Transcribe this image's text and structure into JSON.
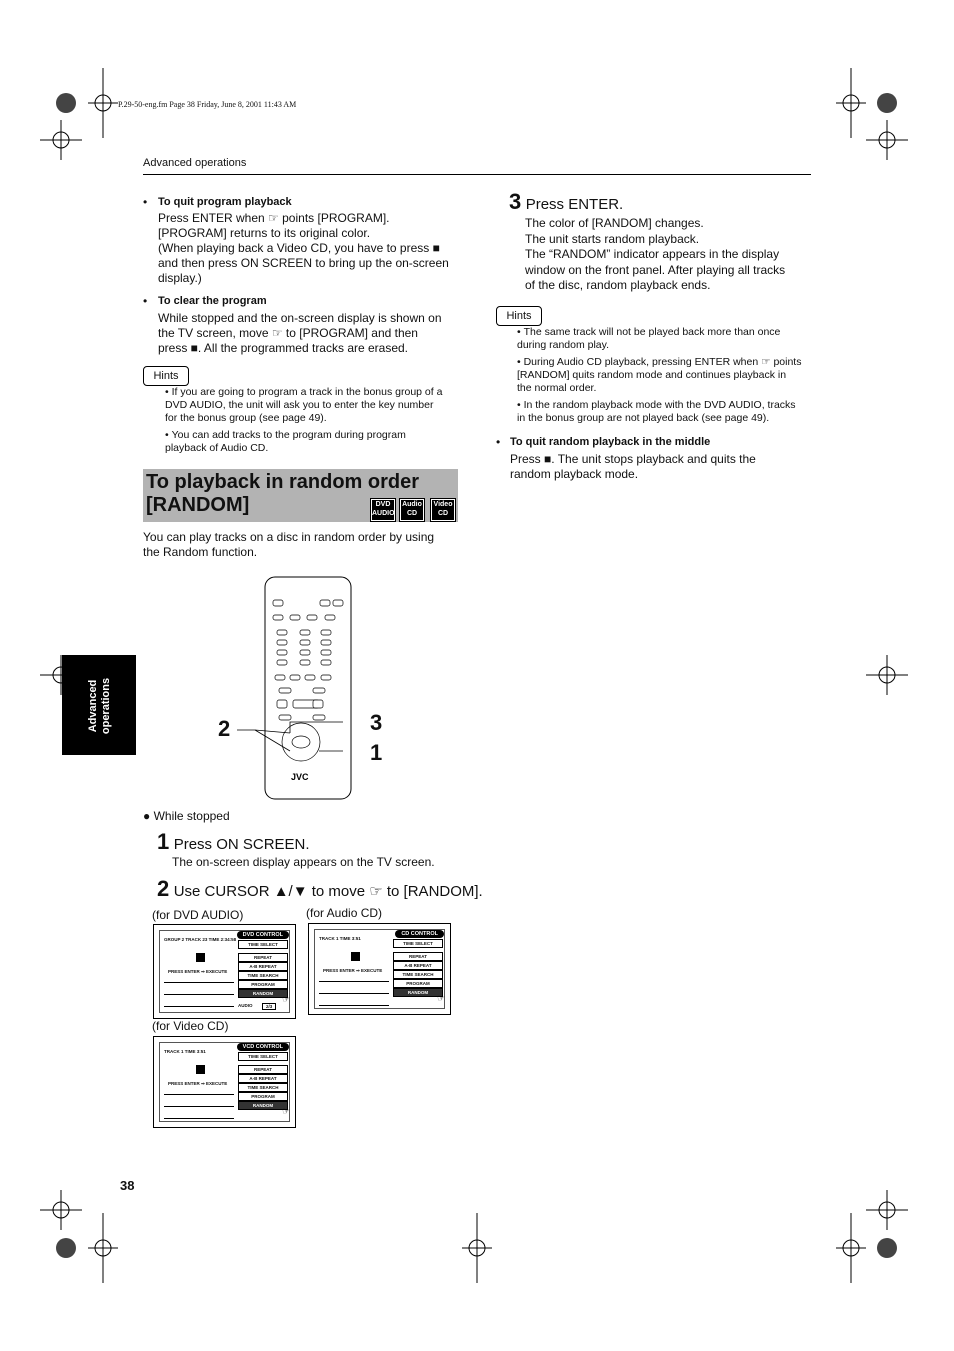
{
  "file_info": "P.29-50-eng.fm  Page 38  Friday, June 8, 2001  11:43 AM",
  "header": "Advanced operations",
  "side_tab": [
    "Advanced",
    "operations"
  ],
  "page_number": "38",
  "left": {
    "quit_program": {
      "heading": "To quit program playback",
      "lines": [
        "Press ENTER when ☞ points [PROGRAM].",
        "[PROGRAM] returns to its original color.",
        "(When playing back a Video CD, you have to press ■",
        "and then press ON SCREEN to bring up the on-screen",
        "display.)"
      ]
    },
    "clear_program": {
      "heading": "To clear the program",
      "lines": [
        "While stopped and the on-screen display is shown on",
        "the TV screen, move ☞ to [PROGRAM] and then",
        "press ■. All the programmed tracks are erased."
      ]
    },
    "hints_label": "Hints",
    "hints": [
      [
        "If you are going to program a track in the bonus group of a",
        "DVD AUDIO, the unit will ask you to enter the key number",
        "for the bonus group (see page 49)."
      ],
      [
        "You can add tracks to the program during program",
        "playback of Audio CD."
      ]
    ],
    "section_title": [
      "To playback  in random order",
      "[RANDOM]"
    ],
    "badges": [
      [
        "DVD",
        "AUDIO"
      ],
      [
        "Audio",
        "CD"
      ],
      [
        "Video",
        "CD"
      ]
    ],
    "intro": [
      "You can play tracks on a disc in random order by using",
      "the Random function."
    ],
    "remote_brand": "JVC",
    "callouts": [
      "2",
      "3",
      "1"
    ],
    "while_stopped": "While stopped",
    "step1": {
      "num": "1",
      "title": "Press ON SCREEN.",
      "desc": "The on-screen display appears on the TV screen."
    },
    "step2": {
      "num": "2",
      "title": "Use CURSOR ▲/▼ to move ☞ to [RANDOM]."
    },
    "captions": {
      "dvd": "(for DVD AUDIO)",
      "cd": "(for Audio CD)",
      "vcd": "(for Video CD)"
    }
  },
  "right": {
    "step3": {
      "num": "3",
      "title": "Press ENTER.",
      "lines": [
        "The color of [RANDOM] changes.",
        "The unit starts random playback.",
        "The “RANDOM” indicator appears in the display",
        "window on the front panel. After playing all tracks",
        "of the disc, random playback ends."
      ]
    },
    "hints_label": "Hints",
    "hints": [
      [
        "The same track will not be played back more than once",
        "during random play."
      ],
      [
        "During Audio CD playback, pressing ENTER when ☞ points",
        "[RANDOM] quits random mode and continues playback in",
        "the normal order."
      ],
      [
        "In the random playback mode with the DVD AUDIO, tracks",
        "in the bonus group are not played back (see page 49)."
      ]
    ],
    "quit_random": {
      "heading": "To quit random playback in the middle",
      "lines": [
        "Press ■. The unit stops playback and quits the",
        "random playback mode."
      ]
    }
  },
  "screens": {
    "dvd": {
      "title": "DVD CONTROL",
      "info": "GROUP 2  TRACK 23  TIME 2:34:58",
      "menu": [
        "TIME SELECT",
        "REPEAT",
        "A-B REPEAT",
        "TIME SEARCH",
        "PROGRAM",
        "RANDOM"
      ],
      "audio": "AUDIO",
      "audio_val": "2/3"
    },
    "cd": {
      "title": "CD CONTROL",
      "info": "TRACK 1   TIME 3:51",
      "menu": [
        "TIME SELECT",
        "REPEAT",
        "A-B REPEAT",
        "TIME SEARCH",
        "PROGRAM",
        "RANDOM"
      ]
    },
    "vcd": {
      "title": "VCD CONTROL",
      "info": "TRACK 1   TIME 3:51",
      "menu": [
        "TIME SELECT",
        "REPEAT",
        "A-B REPEAT",
        "TIME SEARCH",
        "PROGRAM",
        "RANDOM"
      ]
    },
    "press_enter": "PRESS ENTER ⇒ EXECUTE",
    "selected": "RANDOM"
  }
}
